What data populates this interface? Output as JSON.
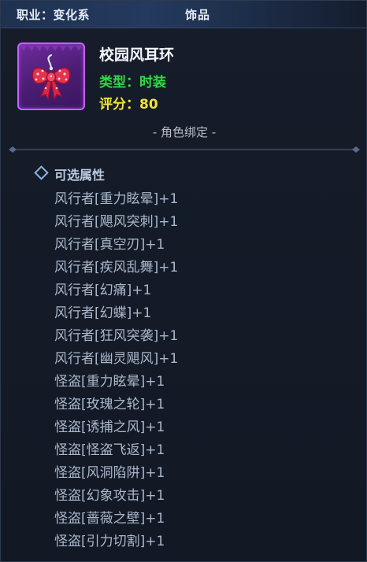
{
  "header": {
    "job_label": "职业：变化系",
    "item_category": "饰品"
  },
  "item": {
    "icon": "bow-earring-icon",
    "name": "校园风耳环",
    "type_line": "类型：时装",
    "score_line": "评分：80",
    "bind_status": "- 角色绑定 -",
    "frame_color": "#c760ff",
    "type_color": "#34d847",
    "score_color": "#f2e23b"
  },
  "optional_attributes": {
    "title": "可选属性",
    "items": [
      "风行者[重力眩晕]+1",
      "风行者[飓风突刺]+1",
      "风行者[真空刃]+1",
      "风行者[疾风乱舞]+1",
      "风行者[幻痛]+1",
      "风行者[幻蝶]+1",
      "风行者[狂风突袭]+1",
      "风行者[幽灵飓风]+1",
      "怪盗[重力眩晕]+1",
      "怪盗[玫瑰之轮]+1",
      "怪盗[诱捕之风]+1",
      "怪盗[怪盗飞返]+1",
      "怪盗[风洞陷阱]+1",
      "怪盗[幻象攻击]+1",
      "怪盗[蔷薇之壁]+1",
      "怪盗[引力切割]+1"
    ]
  }
}
